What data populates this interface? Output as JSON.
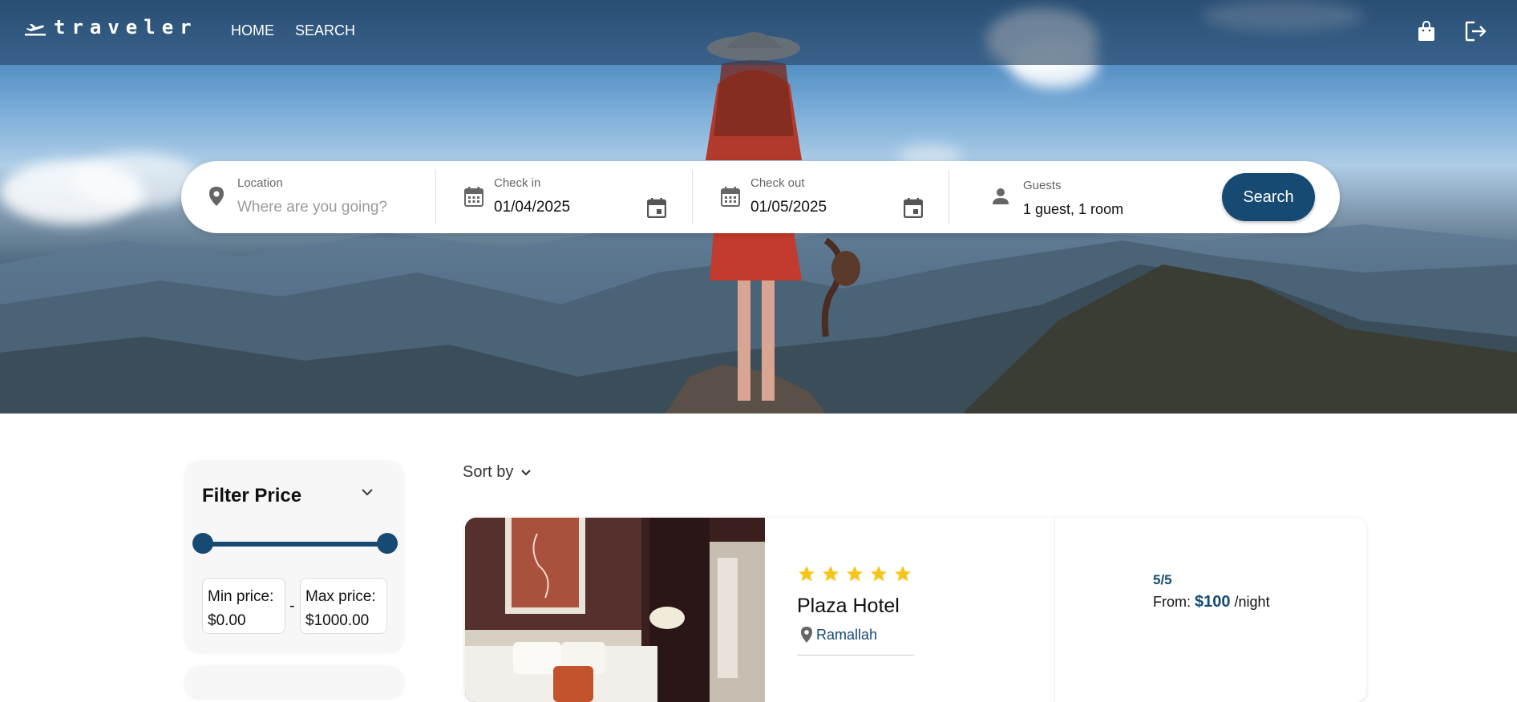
{
  "app": {
    "logo_text": "traveler"
  },
  "nav": {
    "home": "HOME",
    "search": "SEARCH"
  },
  "header_icons": [
    "shopping-bag-icon",
    "logout-icon"
  ],
  "search": {
    "location_label": "Location",
    "location_placeholder": "Where are you going?",
    "checkin_label": "Check in",
    "checkin_value": "01/04/2025",
    "checkout_label": "Check out",
    "checkout_value": "01/05/2025",
    "guests_label": "Guests",
    "guests_value": "1 guest, 1 room",
    "button_label": "Search"
  },
  "filter": {
    "title": "Filter Price",
    "min_label": "Min price:",
    "min_value": "$0.00",
    "max_label": "Max price:",
    "max_value": "$1000.00",
    "separator": "-"
  },
  "sort": {
    "label": "Sort by"
  },
  "results": [
    {
      "name": "Plaza Hotel",
      "stars": 5,
      "location": "Ramallah",
      "rating": "5/5",
      "price_prefix": "From:",
      "price": "$100",
      "price_suffix": "/night"
    }
  ],
  "colors": {
    "primary": "#174a73",
    "star": "#f5c518"
  }
}
